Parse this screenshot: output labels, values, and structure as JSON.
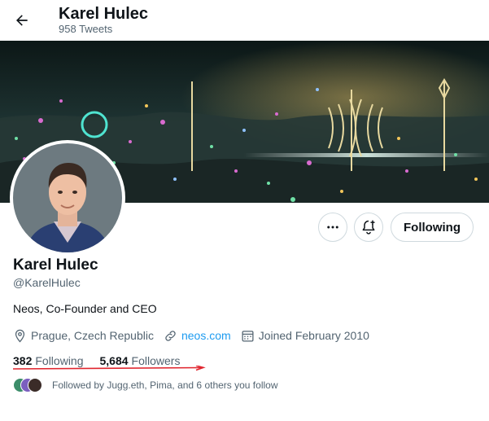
{
  "header": {
    "name": "Karel Hulec",
    "tweet_count": "958 Tweets"
  },
  "profile": {
    "name": "Karel Hulec",
    "handle": "@KarelHulec",
    "bio": "Neos, Co-Founder and CEO",
    "location": "Prague, Czech Republic",
    "website": "neos.com",
    "joined": "Joined February 2010"
  },
  "actions": {
    "following_label": "Following"
  },
  "stats": {
    "following_count": "382",
    "following_label": "Following",
    "followers_count": "5,684",
    "followers_label": "Followers"
  },
  "followed_by": "Followed by Jugg.eth, Pima, and 6 others you follow",
  "colors": {
    "accent": "#1d9bf0",
    "text_secondary": "#536471",
    "annotation_red": "#e0252e",
    "banner_bg": "#1c2a2a"
  },
  "icons": [
    "back-arrow-icon",
    "more-icon",
    "notification-bell-icon",
    "location-icon",
    "link-icon",
    "calendar-icon"
  ]
}
